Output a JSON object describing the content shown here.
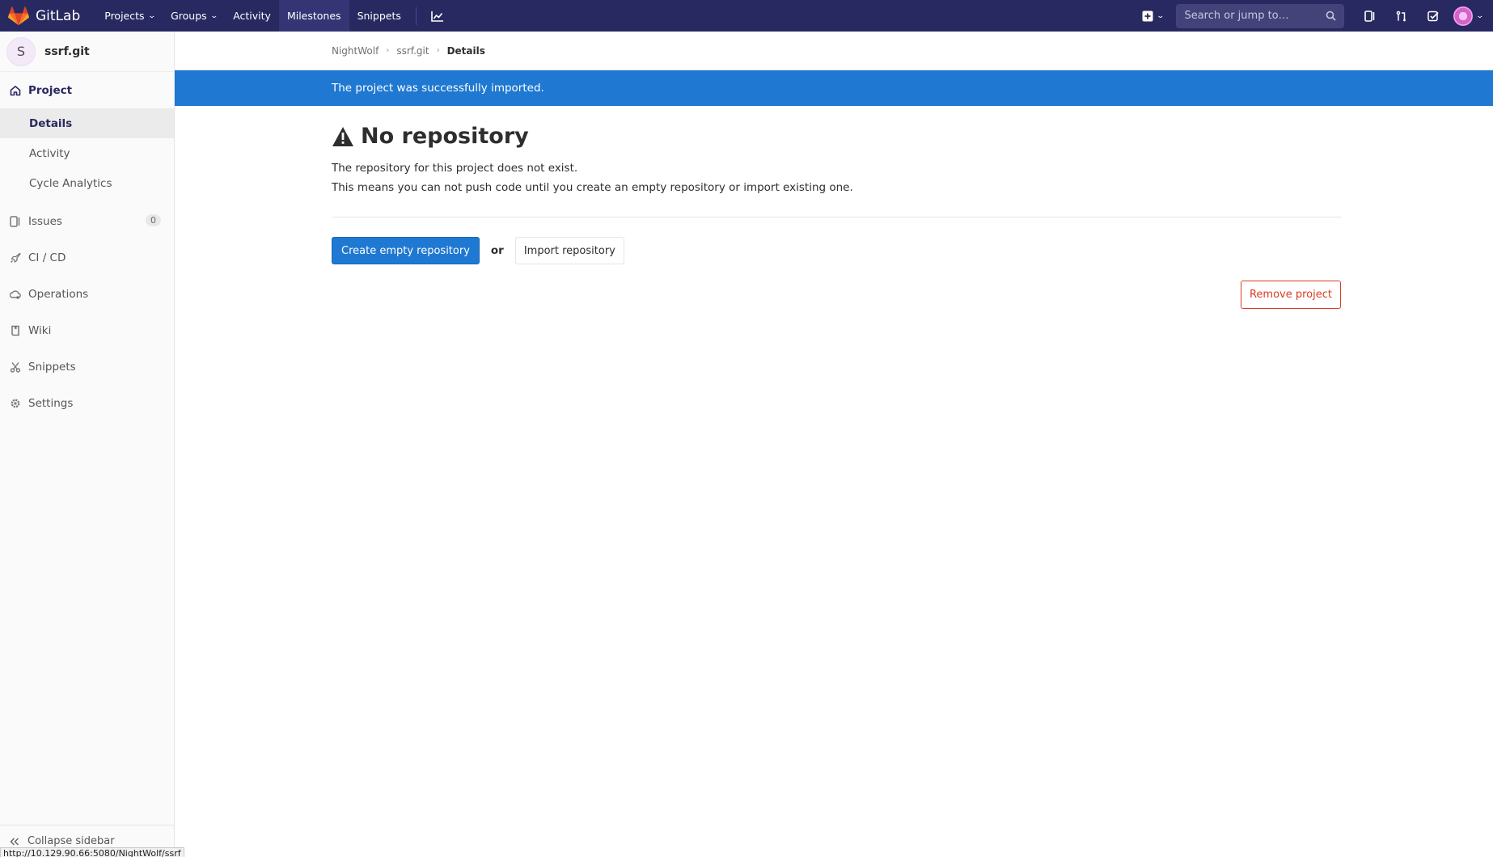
{
  "navbar": {
    "brand": "GitLab",
    "links": [
      {
        "label": "Projects",
        "dropdown": true
      },
      {
        "label": "Groups",
        "dropdown": true
      },
      {
        "label": "Activity",
        "dropdown": false
      },
      {
        "label": "Milestones",
        "dropdown": false
      },
      {
        "label": "Snippets",
        "dropdown": false
      }
    ],
    "search_placeholder": "Search or jump to…",
    "icons": [
      "plus-square-icon",
      "issues-icon",
      "merge-request-icon",
      "todo-icon",
      "avatar"
    ]
  },
  "sidebar": {
    "project_initial": "S",
    "project_name": "ssrf.git",
    "project_label": "Project",
    "sub_items": [
      "Details",
      "Activity",
      "Cycle Analytics"
    ],
    "issues_label": "Issues",
    "issues_count": "0",
    "items": [
      "CI / CD",
      "Operations",
      "Wiki",
      "Snippets",
      "Settings"
    ],
    "collapse_label": "Collapse sidebar"
  },
  "breadcrumb": {
    "owner": "NightWolf",
    "project": "ssrf.git",
    "current": "Details"
  },
  "flash": {
    "message": "The project was successfully imported."
  },
  "main": {
    "title": "No repository",
    "line1": "The repository for this project does not exist.",
    "line2": "This means you can not push code until you create an empty repository or import existing one.",
    "create_button": "Create empty repository",
    "or_text": "or",
    "import_button": "Import repository",
    "remove_button": "Remove project"
  },
  "statusbar": {
    "url": "http://10.129.90.66:5080/NightWolf/ssrf"
  },
  "colors": {
    "navbar": "#292961",
    "primary": "#1f78d1",
    "danger": "#db3b21"
  }
}
